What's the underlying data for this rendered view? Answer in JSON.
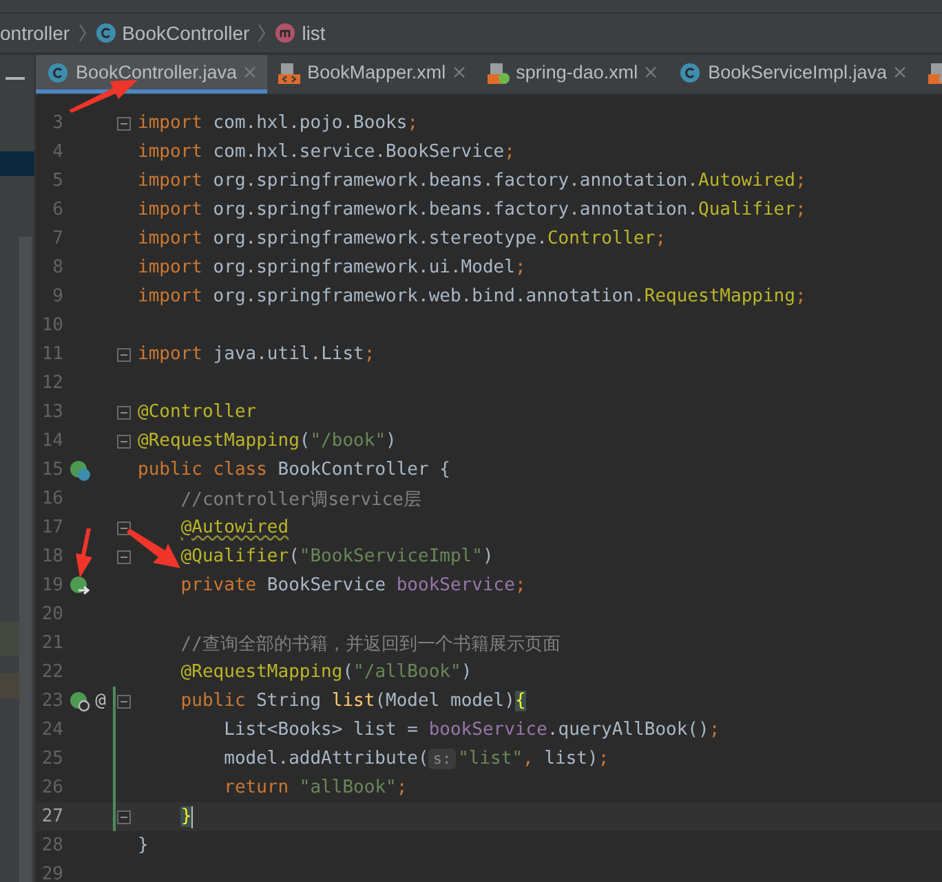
{
  "breadcrumb": [
    {
      "label": "ontroller"
    },
    {
      "label": "BookController",
      "kind": "class"
    },
    {
      "label": "list",
      "kind": "method"
    }
  ],
  "tabs": [
    {
      "label": "BookController.java",
      "kind": "class",
      "selected": true
    },
    {
      "label": "BookMapper.xml",
      "kind": "xml",
      "selected": false
    },
    {
      "label": "spring-dao.xml",
      "kind": "spring-xml",
      "selected": false
    },
    {
      "label": "BookServiceImpl.java",
      "kind": "class",
      "selected": false
    },
    {
      "kind": "web-xml",
      "selected": false
    }
  ],
  "editor": {
    "lines": [
      {
        "number": "3",
        "fold": true,
        "tokens": [
          {
            "kind": "kw",
            "text": "import "
          },
          {
            "kind": "text",
            "text": "com.hxl.pojo.Books"
          },
          {
            "kind": "punct",
            "text": ";"
          }
        ]
      },
      {
        "number": "4",
        "tokens": [
          {
            "kind": "kw",
            "text": "import "
          },
          {
            "kind": "text",
            "text": "com.hxl.service.BookService"
          },
          {
            "kind": "punct",
            "text": ";"
          }
        ]
      },
      {
        "number": "5",
        "tokens": [
          {
            "kind": "kw",
            "text": "import "
          },
          {
            "kind": "text",
            "text": "org.springframework.beans.factory.annotation."
          },
          {
            "kind": "ann",
            "text": "Autowired"
          },
          {
            "kind": "punct",
            "text": ";"
          }
        ]
      },
      {
        "number": "6",
        "tokens": [
          {
            "kind": "kw",
            "text": "import "
          },
          {
            "kind": "text",
            "text": "org.springframework.beans.factory.annotation."
          },
          {
            "kind": "ann",
            "text": "Qualifier"
          },
          {
            "kind": "punct",
            "text": ";"
          }
        ]
      },
      {
        "number": "7",
        "tokens": [
          {
            "kind": "kw",
            "text": "import "
          },
          {
            "kind": "text",
            "text": "org.springframework.stereotype."
          },
          {
            "kind": "ann",
            "text": "Controller"
          },
          {
            "kind": "punct",
            "text": ";"
          }
        ]
      },
      {
        "number": "8",
        "tokens": [
          {
            "kind": "kw",
            "text": "import "
          },
          {
            "kind": "text",
            "text": "org.springframework.ui.Model"
          },
          {
            "kind": "punct",
            "text": ";"
          }
        ]
      },
      {
        "number": "9",
        "tokens": [
          {
            "kind": "kw",
            "text": "import "
          },
          {
            "kind": "text",
            "text": "org.springframework.web.bind.annotation."
          },
          {
            "kind": "ann",
            "text": "RequestMapping"
          },
          {
            "kind": "punct",
            "text": ";"
          }
        ]
      },
      {
        "number": "10"
      },
      {
        "number": "11",
        "fold": true,
        "tokens": [
          {
            "kind": "kw",
            "text": "import "
          },
          {
            "kind": "text",
            "text": "java.util.List"
          },
          {
            "kind": "punct",
            "text": ";"
          }
        ]
      },
      {
        "number": "12"
      },
      {
        "number": "13",
        "fold": true,
        "tokens": [
          {
            "kind": "ann",
            "text": "@Controller"
          }
        ]
      },
      {
        "number": "14",
        "fold": true,
        "tokens": [
          {
            "kind": "ann",
            "text": "@RequestMapping"
          },
          {
            "kind": "text",
            "text": "("
          },
          {
            "kind": "str",
            "text": "\"/book\""
          },
          {
            "kind": "text",
            "text": ")"
          }
        ]
      },
      {
        "number": "15",
        "kind": "bean-class",
        "tokens": [
          {
            "kind": "kw",
            "text": "public class "
          },
          {
            "kind": "text",
            "text": "BookController {"
          }
        ]
      },
      {
        "number": "16",
        "tokens": [
          {
            "kind": "cmt",
            "text": "    //controller调service层"
          }
        ]
      },
      {
        "number": "17",
        "fold": true,
        "tokens": [
          {
            "kind": "ann-warn",
            "text": "    @Autowired"
          }
        ]
      },
      {
        "number": "18",
        "fold": true,
        "tokens": [
          {
            "kind": "ann",
            "text": "    @Qualifier"
          },
          {
            "kind": "text",
            "text": "("
          },
          {
            "kind": "str",
            "text": "\"BookServiceImpl\""
          },
          {
            "kind": "text",
            "text": ")"
          }
        ]
      },
      {
        "number": "19",
        "kind": "bean-injected",
        "tokens": [
          {
            "kind": "kw",
            "text": "    private "
          },
          {
            "kind": "text",
            "text": "BookService "
          },
          {
            "kind": "field",
            "text": "bookService"
          },
          {
            "kind": "punct",
            "text": ";"
          }
        ]
      },
      {
        "number": "20"
      },
      {
        "number": "21",
        "tokens": [
          {
            "kind": "cmt",
            "text": "    //查询全部的书籍，并返回到一个书籍展示页面"
          }
        ]
      },
      {
        "number": "22",
        "tokens": [
          {
            "kind": "ann",
            "text": "    @RequestMapping"
          },
          {
            "kind": "text",
            "text": "("
          },
          {
            "kind": "str",
            "text": "\"/allBook\""
          },
          {
            "kind": "text",
            "text": ")"
          }
        ]
      },
      {
        "number": "23",
        "kind": "bean-method",
        "marker": "@",
        "fold": true,
        "changed": true,
        "tokens": [
          {
            "kind": "kw",
            "text": "    public "
          },
          {
            "kind": "text",
            "text": "String "
          },
          {
            "kind": "method",
            "text": "list"
          },
          {
            "kind": "text",
            "text": "(Model model)"
          },
          {
            "kind": "brace",
            "text": "{"
          }
        ]
      },
      {
        "number": "24",
        "changed": true,
        "tokens": [
          {
            "kind": "text",
            "text": "        List<Books> list = "
          },
          {
            "kind": "field",
            "text": "bookService"
          },
          {
            "kind": "text",
            "text": ".queryAllBook()"
          },
          {
            "kind": "punct",
            "text": ";"
          }
        ]
      },
      {
        "number": "25",
        "changed": true,
        "tokens": [
          {
            "kind": "text",
            "text": "        model.addAttribute("
          },
          {
            "kind": "hint",
            "text": "s:"
          },
          {
            "kind": "str",
            "text": "\"list\""
          },
          {
            "kind": "punct",
            "text": ","
          },
          {
            "kind": "text",
            "text": " list)"
          },
          {
            "kind": "punct",
            "text": ";"
          }
        ]
      },
      {
        "number": "26",
        "changed": true,
        "tokens": [
          {
            "kind": "kw",
            "text": "        return "
          },
          {
            "kind": "str",
            "text": "\"allBook\""
          },
          {
            "kind": "punct",
            "text": ";"
          }
        ]
      },
      {
        "number": "27",
        "fold": true,
        "changed": true,
        "current": true,
        "tokens": [
          {
            "kind": "brace",
            "text": "    }"
          }
        ]
      },
      {
        "number": "28",
        "tokens": [
          {
            "kind": "text",
            "text": "}"
          }
        ]
      },
      {
        "number": "29"
      }
    ]
  }
}
